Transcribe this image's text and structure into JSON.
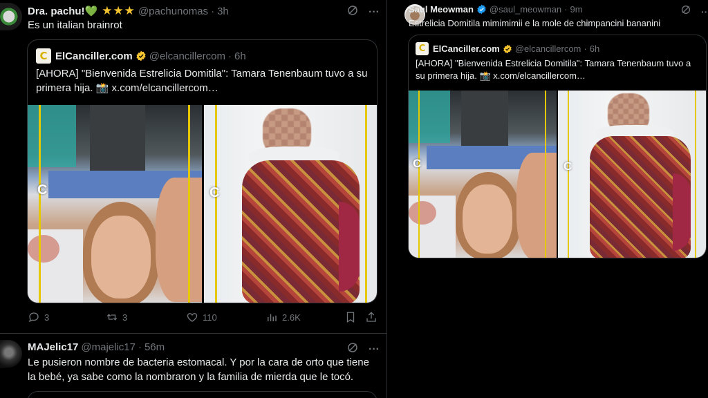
{
  "left": {
    "post1": {
      "name": "Dra. pachu!💚",
      "stars": "★★★",
      "handle": "@pachunomas",
      "time": "3h",
      "text": "Es un italian brainrot",
      "quote": {
        "name": "ElCanciller.com",
        "handle": "@elcancillercom",
        "time": "6h",
        "text": "[AHORA] \"Bienvenida Estrelicia Domitila\": Tamara Tenenbaum tuvo a su primera hija. 📸 x.com/elcancillercom…",
        "logo_letter": "C",
        "watermark": "C"
      },
      "actions": {
        "replies": "3",
        "reposts": "3",
        "likes": "110",
        "views": "2.6K"
      }
    },
    "post2": {
      "name": "MAJelic17",
      "handle": "@majelic17",
      "time": "56m",
      "text": "Le pusieron nombre de bacteria estomacal. Y por la cara de orto que tiene la bebé, ya sabe como la nombraron y la familia de mierda que le tocó."
    }
  },
  "right": {
    "post": {
      "name": "Saul Meowman",
      "handle": "@saul_meowman",
      "time": "9m",
      "text": "Estrelicia Domitila mimimimii e la mole de chimpancini bananini",
      "quote": {
        "name": "ElCanciller.com",
        "handle": "@elcancillercom",
        "time": "6h",
        "text": "[AHORA] \"Bienvenida Estrelicia Domitila\": Tamara Tenenbaum tuvo a su primera hija. 📸 x.com/elcancillercom…",
        "logo_letter": "C",
        "watermark": "C"
      }
    }
  },
  "ui": {
    "dot": "·",
    "more": "···"
  },
  "colors": {
    "background": "#000000",
    "text": "#e7e9ea",
    "muted": "#71767b",
    "border": "#2f3336",
    "verified": "#f4c430"
  }
}
